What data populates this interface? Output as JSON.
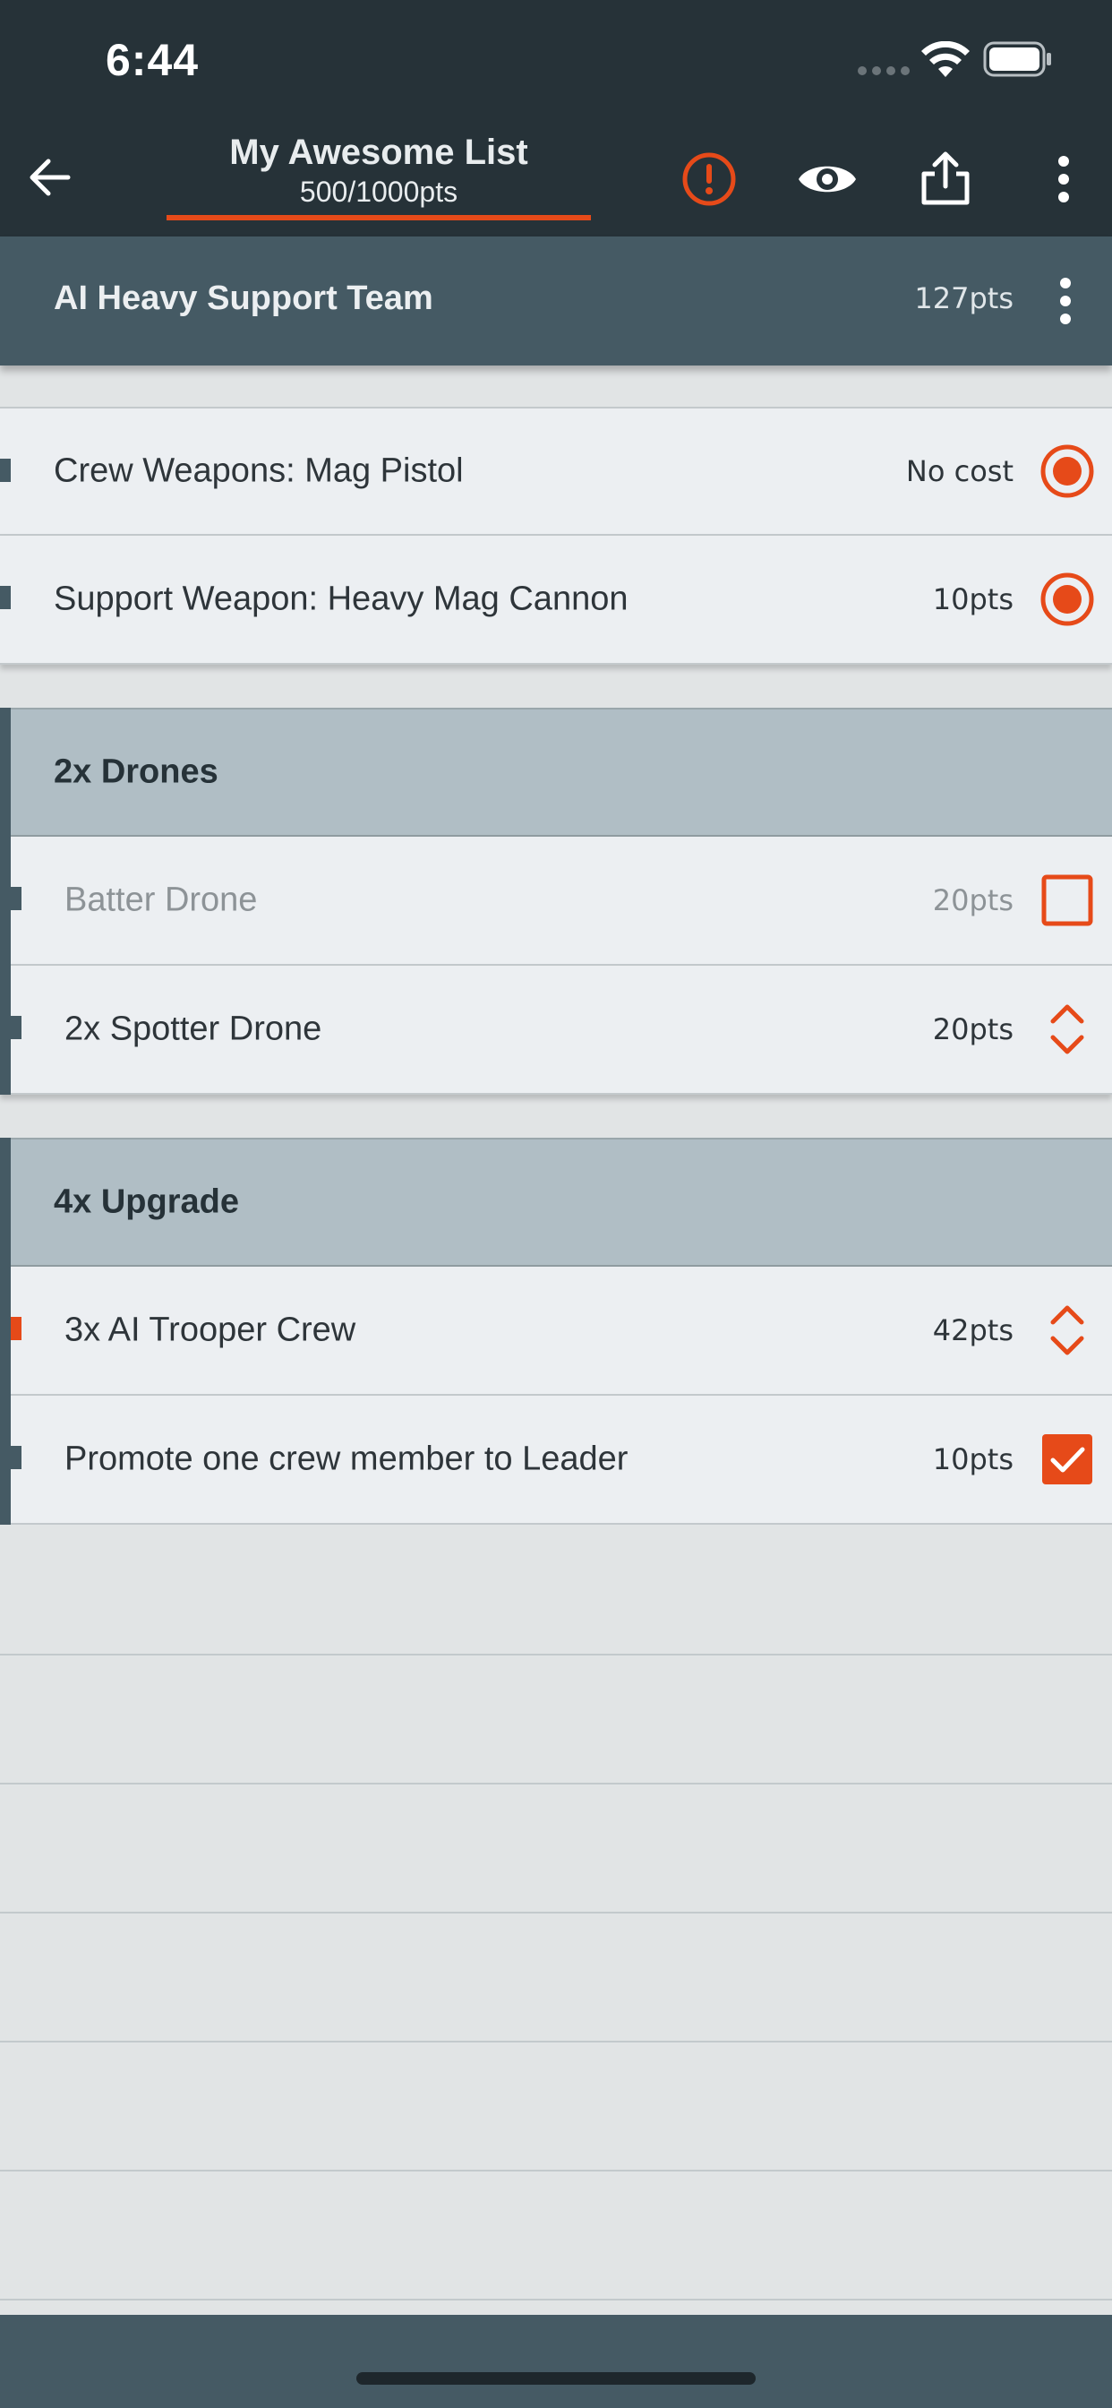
{
  "status": {
    "time": "6:44"
  },
  "app_bar": {
    "title": "My Awesome List",
    "points": "500/1000pts",
    "icons": [
      "back-arrow-icon",
      "alert-circle-icon",
      "eye-icon",
      "share-icon",
      "more-vertical-icon"
    ]
  },
  "unit": {
    "name": "AI Heavy Support Team",
    "points": "127pts"
  },
  "weapons": [
    {
      "label": "Crew Weapons: Mag Pistol",
      "price": "No cost",
      "control": "radio-selected"
    },
    {
      "label": "Support Weapon: Heavy Mag Cannon",
      "price": "10pts",
      "control": "radio-selected"
    }
  ],
  "groups": [
    {
      "title": "2x Drones",
      "items": [
        {
          "label": "Batter Drone",
          "price": "20pts",
          "control": "checkbox-unchecked",
          "disabled": true
        },
        {
          "label": "2x Spotter Drone",
          "price": "20pts",
          "control": "stepper"
        }
      ]
    },
    {
      "title": "4x Upgrade",
      "items": [
        {
          "label": "3x AI Trooper Crew",
          "price": "42pts",
          "control": "stepper",
          "warning": true
        },
        {
          "label": "Promote one crew member to Leader",
          "price": "10pts",
          "control": "checkbox-checked"
        }
      ]
    }
  ],
  "colors": {
    "accent": "#e64a19",
    "header_dark": "#263238",
    "unit_header": "#455a64",
    "group_header": "#b0bec5",
    "row_bg": "#eceff2"
  }
}
